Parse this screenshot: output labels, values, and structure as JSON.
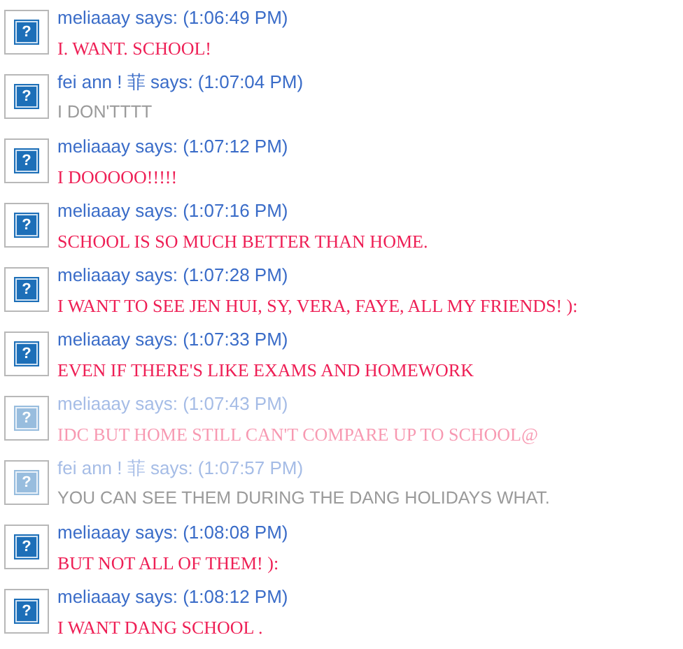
{
  "messages": [
    {
      "avatar": "?",
      "header": "meliaaay says: (1:06:49 PM)",
      "body": "I. WANT. SCHOOL!",
      "kind": "serif",
      "faded": false
    },
    {
      "avatar": "?",
      "header": "fei ann ! 菲 says: (1:07:04 PM)",
      "body": "I DON'TTTT",
      "kind": "sans",
      "faded": false
    },
    {
      "avatar": "?",
      "header": "meliaaay says: (1:07:12 PM)",
      "body": "I DOOOOO!!!!!",
      "kind": "serif",
      "faded": false
    },
    {
      "avatar": "?",
      "header": "meliaaay says: (1:07:16 PM)",
      "body": "SCHOOL IS SO MUCH BETTER THAN HOME.",
      "kind": "serif",
      "faded": false
    },
    {
      "avatar": "?",
      "header": "meliaaay says: (1:07:28 PM)",
      "body": "I WANT TO SEE JEN HUI, SY, VERA, FAYE, ALL MY FRIENDS! ):",
      "kind": "serif",
      "faded": false
    },
    {
      "avatar": "?",
      "header": "meliaaay says: (1:07:33 PM)",
      "body": "EVEN IF THERE'S LIKE EXAMS AND HOMEWORK",
      "kind": "serif",
      "faded": false
    },
    {
      "avatar": "?",
      "header": "meliaaay says: (1:07:43 PM)",
      "body": "IDC BUT HOME STILL CAN'T COMPARE UP TO SCHOOL@",
      "kind": "serif",
      "faded": true
    },
    {
      "avatar": "?",
      "header": "fei ann ! 菲 says: (1:07:57 PM)",
      "body": "YOU CAN SEE THEM DURING THE DANG HOLIDAYS WHAT.",
      "kind": "sans",
      "faded": true
    },
    {
      "avatar": "?",
      "header": "meliaaay says: (1:08:08 PM)",
      "body": "BUT NOT ALL OF THEM! ):",
      "kind": "serif",
      "faded": false
    },
    {
      "avatar": "?",
      "header": "meliaaay says: (1:08:12 PM)",
      "body": "I WANT DANG SCHOOL .",
      "kind": "serif",
      "faded": false
    }
  ]
}
